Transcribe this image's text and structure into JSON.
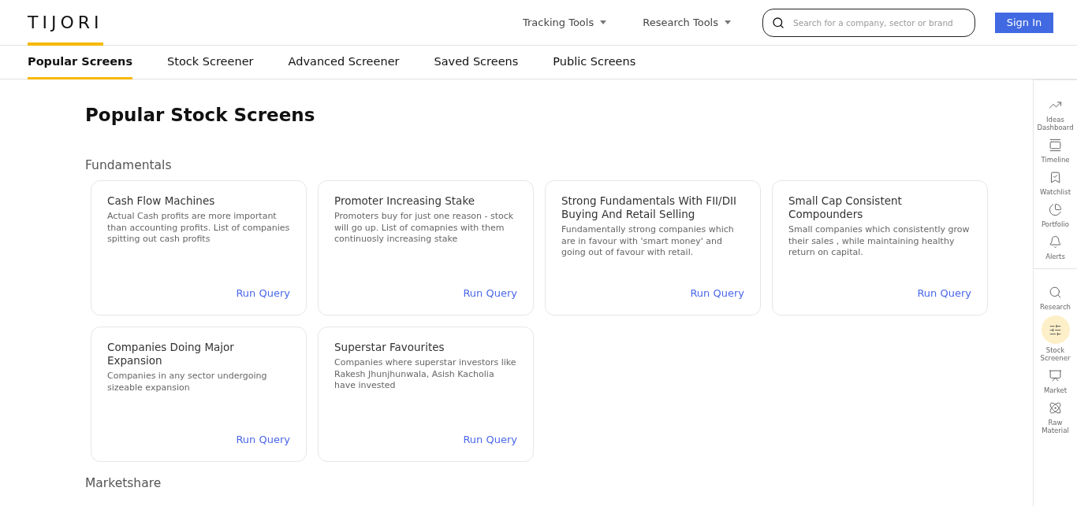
{
  "logo": "TIJORI",
  "nav": [
    {
      "label": "Tracking Tools"
    },
    {
      "label": "Research Tools"
    }
  ],
  "search": {
    "placeholder": "Search for a company, sector or brand"
  },
  "sign_in": "Sign In",
  "tabs": [
    {
      "label": "Popular Screens",
      "selected": true
    },
    {
      "label": "Stock Screener",
      "selected": false
    },
    {
      "label": "Advanced Screener",
      "selected": false
    },
    {
      "label": "Saved Screens",
      "selected": false
    },
    {
      "label": "Public Screens",
      "selected": false
    }
  ],
  "page_title": "Popular Stock Screens",
  "sections": [
    {
      "heading": "Fundamentals",
      "cards": [
        {
          "title": "Cash Flow Machines",
          "description": "Actual Cash profits are more important than accounting profits. List of companies spitting out cash profits",
          "action": "Run Query"
        },
        {
          "title": "Promoter Increasing Stake",
          "description": "Promoters buy for just one reason - stock will go up. List of comapnies with them continuosly increasing stake",
          "action": "Run Query"
        },
        {
          "title": "Strong Fundamentals With FII/DII Buying And Retail Selling",
          "description": "Fundamentally strong companies which are in favour with 'smart money' and going out of favour with retail.",
          "action": "Run Query"
        },
        {
          "title": "Small Cap Consistent Compounders",
          "description": "Small companies which consistently grow their sales , while maintaining healthy return on capital.",
          "action": "Run Query"
        },
        {
          "title": "Companies Doing Major Expansion",
          "description": "Companies in any sector undergoing sizeable expansion",
          "action": "Run Query"
        },
        {
          "title": "Superstar Favourites",
          "description": "Companies where superstar investors like Rakesh Jhunjhunwala, Asish Kacholia have invested",
          "action": "Run Query"
        }
      ]
    },
    {
      "heading": "Marketshare"
    }
  ],
  "rail": [
    [
      {
        "label": "Ideas Dashboard",
        "selected": false
      },
      {
        "label": "Timeline",
        "selected": false
      },
      {
        "label": "Watchlist",
        "selected": false
      },
      {
        "label": "Portfolio",
        "selected": false
      },
      {
        "label": "Alerts",
        "selected": false
      }
    ],
    [
      {
        "label": "Research",
        "selected": false
      },
      {
        "label": "Stock Screener",
        "selected": true
      },
      {
        "label": "Market",
        "selected": false
      },
      {
        "label": "Raw Material",
        "selected": false
      }
    ]
  ]
}
